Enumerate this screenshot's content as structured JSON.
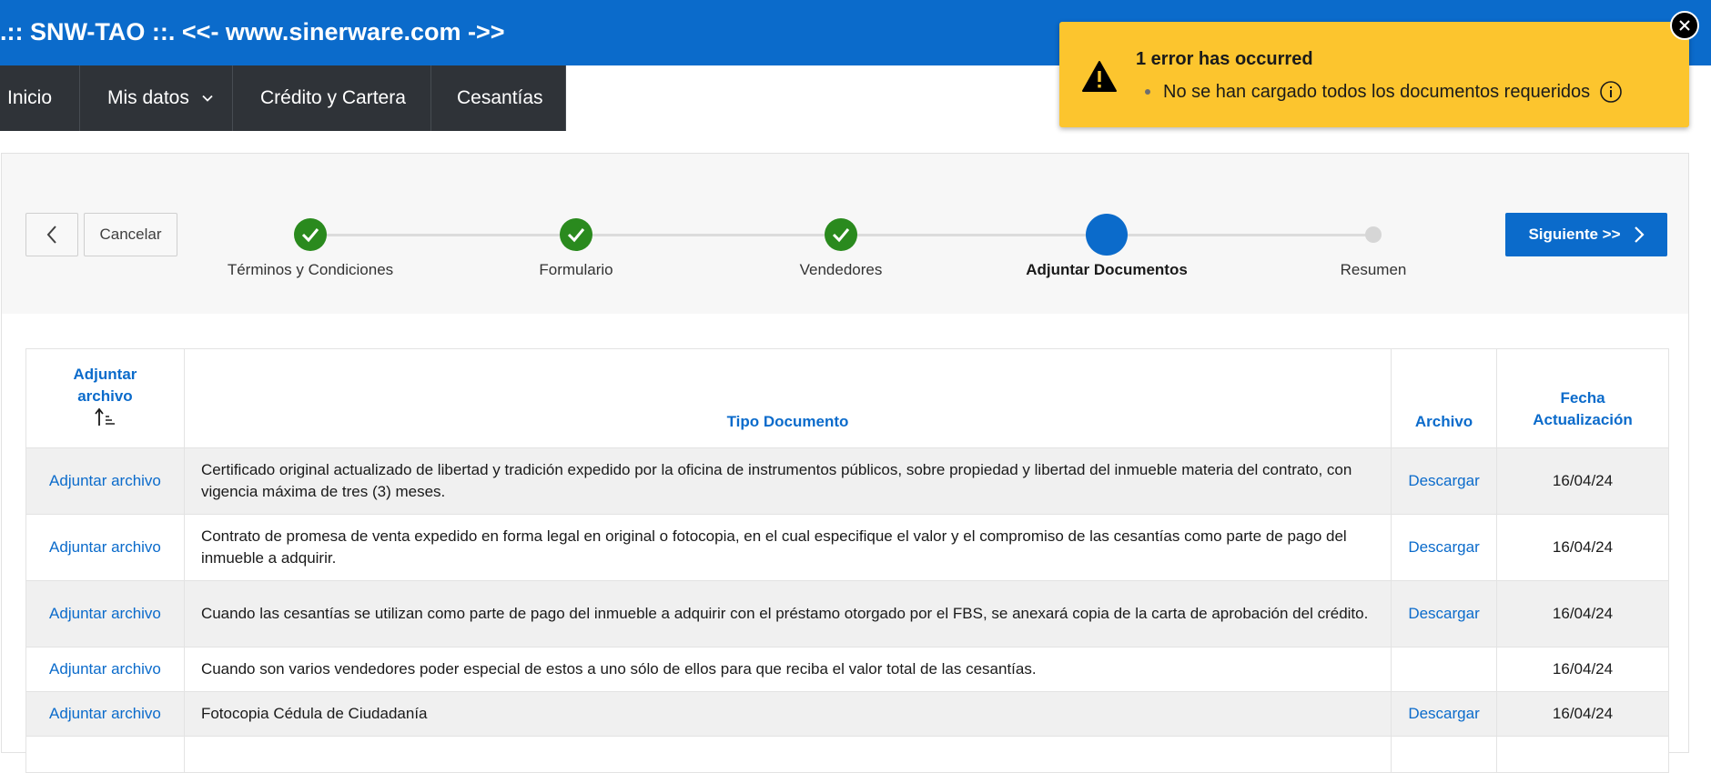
{
  "header": {
    "title": ".:: SNW-TAO ::. <<- www.sinerware.com ->>"
  },
  "nav": [
    {
      "label": "Inicio"
    },
    {
      "label": "Mis datos"
    },
    {
      "label": "Crédito y Cartera"
    },
    {
      "label": "Cesantías"
    }
  ],
  "wizard": {
    "cancel_label": "Cancelar",
    "next_label": "Siguiente >>",
    "steps": [
      {
        "label": "Términos y Condiciones",
        "state": "done"
      },
      {
        "label": "Formulario",
        "state": "done"
      },
      {
        "label": "Vendedores",
        "state": "done"
      },
      {
        "label": "Adjuntar Documentos",
        "state": "current"
      },
      {
        "label": "Resumen",
        "state": "todo"
      }
    ]
  },
  "table": {
    "headers": {
      "attach": "Adjuntar archivo",
      "sort_icon": "sort-ascending-icon",
      "type": "Tipo Documento",
      "file": "Archivo",
      "date": "Fecha Actualización"
    },
    "rows": [
      {
        "attach": "Adjuntar archivo",
        "doc": "Certificado original actualizado de libertad y tradición expedido por la oficina de instrumentos públicos, sobre propiedad y libertad del inmueble materia del contrato, con vigencia máxima de tres (3) meses.",
        "file": "Descargar",
        "date": "16/04/24"
      },
      {
        "attach": "Adjuntar archivo",
        "doc": "Contrato de promesa de venta expedido en forma legal en original o fotocopia, en el cual especifique el valor y el compromiso de las cesantías como parte de pago del inmueble a adquirir.",
        "file": "Descargar",
        "date": "16/04/24"
      },
      {
        "attach": "Adjuntar archivo",
        "doc": "Cuando las cesantías se utilizan como parte de pago del inmueble a adquirir con el préstamo otorgado por el FBS, se anexará copia de la carta de aprobación del crédito.",
        "file": "Descargar",
        "date": "16/04/24"
      },
      {
        "attach": "Adjuntar archivo",
        "doc": "Cuando son varios vendedores poder especial de estos a uno sólo de ellos para que reciba el valor total de las cesantías.",
        "file": "",
        "date": "16/04/24"
      },
      {
        "attach": "Adjuntar archivo",
        "doc": "Fotocopia Cédula de Ciudadanía",
        "file": "Descargar",
        "date": "16/04/24"
      }
    ]
  },
  "notification": {
    "title": "1 error has occurred",
    "message": "No se han cargado todos los documentos requeridos",
    "icon": "warning-icon",
    "background": "#fcc52e"
  },
  "colors": {
    "brand": "#0b6bcb",
    "nav": "#2f3338",
    "success": "#2a8a1e"
  }
}
